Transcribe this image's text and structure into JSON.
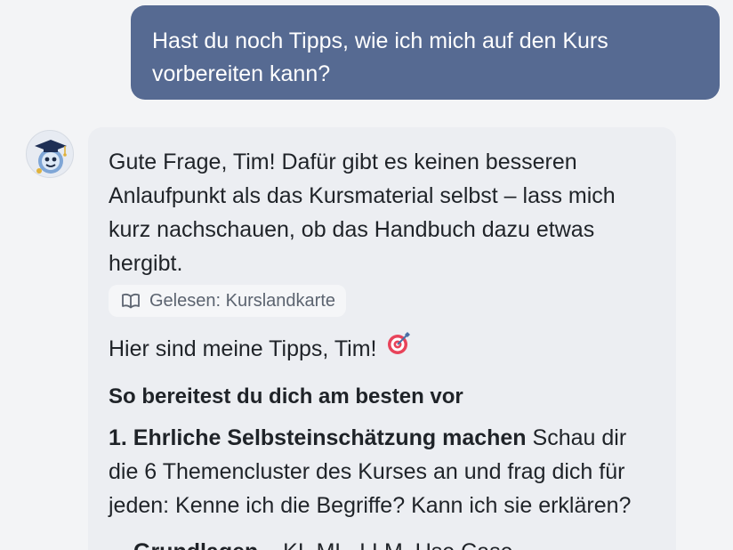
{
  "user_message": {
    "line1": "Hast du noch Tipps, wie ich mich auf den Kurs",
    "line2": "vorbereiten kann?"
  },
  "assistant": {
    "avatar_icon": "graduate-mascot-icon",
    "intro": {
      "line1": "Gute Frage, Tim! Dafür gibt es keinen besseren",
      "line2": "Anlaufpunkt als das Kursmaterial selbst – lass mich",
      "line3": "kurz nachschauen, ob das Handbuch dazu etwas",
      "line4": "hergibt."
    },
    "read_chip": {
      "icon": "open-book-icon",
      "label": "Gelesen: Kurslandkarte"
    },
    "tips_intro": "Hier sind meine Tipps, Tim!",
    "tips_icon": "target-icon",
    "heading": "So bereitest du dich am besten vor",
    "step1": {
      "title": "1. Ehrliche Selbsteinschätzung machen",
      "text_line1": "Schau dir",
      "text_line2": "die 6 Themencluster des Kurses an und frag dich für",
      "text_line3": "jeden: Kenne ich die Begriffe? Kann ich sie erklären?"
    },
    "bullets": [
      {
        "title": "Grundlagen",
        "text": " – KI, ML, LLM, Use Case"
      }
    ]
  }
}
